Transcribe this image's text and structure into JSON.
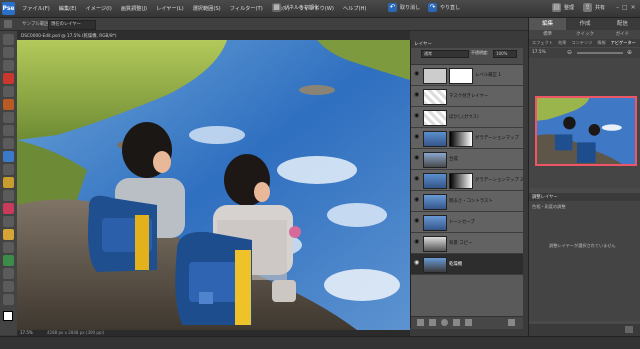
{
  "app": {
    "logo": "Pse"
  },
  "menubar": {
    "items": [
      "ファイル(F)",
      "編集(E)",
      "イメージ(I)",
      "画質調整(J)",
      "レイヤー(L)",
      "選択範囲(S)",
      "フィルター(T)",
      "表示(V)",
      "ウィンドウ(W)",
      "ヘルプ(H)"
    ],
    "panel_label": "パネルを初期化",
    "undo_label": "取り消し",
    "redo_label": "やり直し",
    "organizer_label": "整理",
    "share_label": "共有"
  },
  "options_bar": {
    "mode": "サンプル範囲",
    "mode_value": "現在のレイヤー"
  },
  "document": {
    "tab_label": "DSC0000-Edit.psd @ 17.5% (乾燥機, RGB/8*)"
  },
  "status": {
    "zoom": "17.5%",
    "info": "4288 px x 2848 px (300 ppi)"
  },
  "layers_panel": {
    "title": "レイヤー",
    "blend_mode": "通常",
    "opacity_label": "不透明度:",
    "opacity_value": "100%",
    "layers": [
      {
        "name": "レベル補正 1",
        "selected": false
      },
      {
        "name": "マスク付きレイヤー",
        "selected": false
      },
      {
        "name": "ぼかし(ガウス)",
        "selected": false
      },
      {
        "name": "グラデーションマップ",
        "selected": false
      },
      {
        "name": "合成",
        "selected": false
      },
      {
        "name": "グラデーションマップ 2",
        "selected": false
      },
      {
        "name": "明るさ・コントラスト",
        "selected": false
      },
      {
        "name": "トーンカーブ",
        "selected": false
      },
      {
        "name": "背景 コピー",
        "selected": false
      },
      {
        "name": "乾燥機",
        "selected": true
      }
    ]
  },
  "right_panel": {
    "tabs": [
      "編集",
      "作成",
      "配信"
    ],
    "active_tab": "編集",
    "subtabs": [
      "標準",
      "クイック",
      "ガイド"
    ],
    "filters": [
      "エフェクト",
      "効果",
      "コンテンツ",
      "情報",
      "ナビゲーター"
    ],
    "nav_zoom": "17.5%",
    "adjust_title": "調整レイヤー",
    "adjust_subtitle": "色相・彩度の調整",
    "adjust_msg": "調整レイヤーが選択されていません"
  }
}
